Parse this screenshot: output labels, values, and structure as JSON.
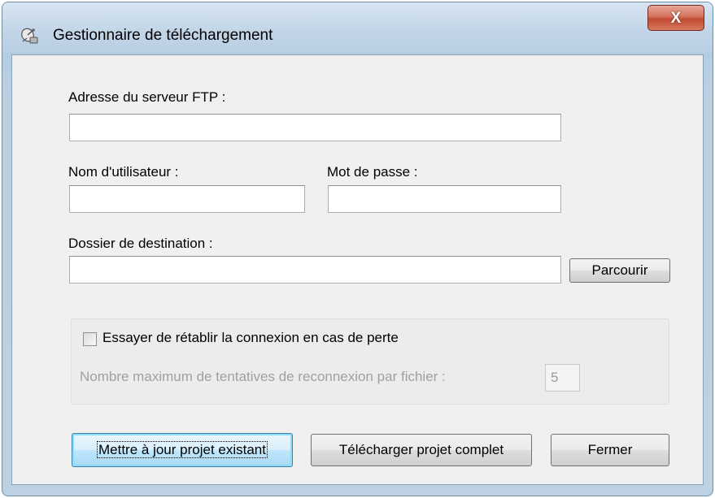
{
  "window": {
    "title": "Gestionnaire de téléchargement",
    "close_label": "X"
  },
  "form": {
    "ftp_label": "Adresse du serveur FTP :",
    "ftp_value": "",
    "user_label": "Nom d'utilisateur :",
    "user_value": "",
    "password_label": "Mot de passe :",
    "password_value": "",
    "dest_label": "Dossier de destination :",
    "dest_value": "",
    "browse_label": "Parcourir"
  },
  "reconnect": {
    "checkbox_label": "Essayer de rétablir la connexion en cas de perte",
    "checked": false,
    "max_label": "Nombre maximum de tentatives de reconnexion par fichier :",
    "max_value": "5"
  },
  "buttons": {
    "update_label": "Mettre à jour projet existant",
    "download_label": "Télécharger projet complet",
    "close_label": "Fermer"
  },
  "colors": {
    "accent": "#3c7fb1",
    "close_button": "#c24a33"
  },
  "icons": {
    "app": "satellite-dish-icon",
    "close": "close-icon"
  }
}
